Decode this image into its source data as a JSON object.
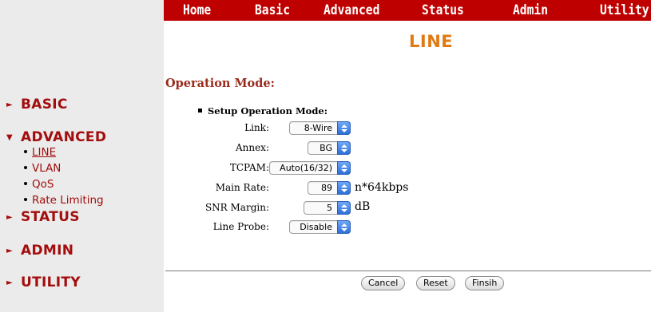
{
  "nav": {
    "items": [
      "Home",
      "Basic",
      "Advanced",
      "Status",
      "Admin",
      "Utility"
    ]
  },
  "page_title": "LINE",
  "sidebar": {
    "basic": "BASIC",
    "advanced": "ADVANCED",
    "advanced_items": [
      "LINE",
      "VLAN",
      "QoS",
      "Rate Limiting"
    ],
    "status": "STATUS",
    "admin": "ADMIN",
    "utility": "UTILITY",
    "arrow_collapsed": "►",
    "arrow_expanded": "▼"
  },
  "section": {
    "title": "Operation Mode:",
    "subtitle": "Setup Operation Mode:"
  },
  "form": {
    "link": {
      "label": "Link:",
      "value": "8-Wire"
    },
    "annex": {
      "label": "Annex:",
      "value": "BG"
    },
    "tcpam": {
      "label": "TCPAM:",
      "value": "Auto(16/32)"
    },
    "main_rate": {
      "label": "Main Rate:",
      "value": "89",
      "unit": "n*64kbps"
    },
    "snr_margin": {
      "label": "SNR Margin:",
      "value": "5",
      "unit": "dB"
    },
    "line_probe": {
      "label": "Line Probe:",
      "value": "Disable"
    }
  },
  "buttons": {
    "cancel": "Cancel",
    "reset": "Reset",
    "finish": "Finsih"
  },
  "colors": {
    "nav_bg": "#bf0000",
    "sidebar_text": "#a30d0d",
    "title_orange": "#e07a14"
  }
}
